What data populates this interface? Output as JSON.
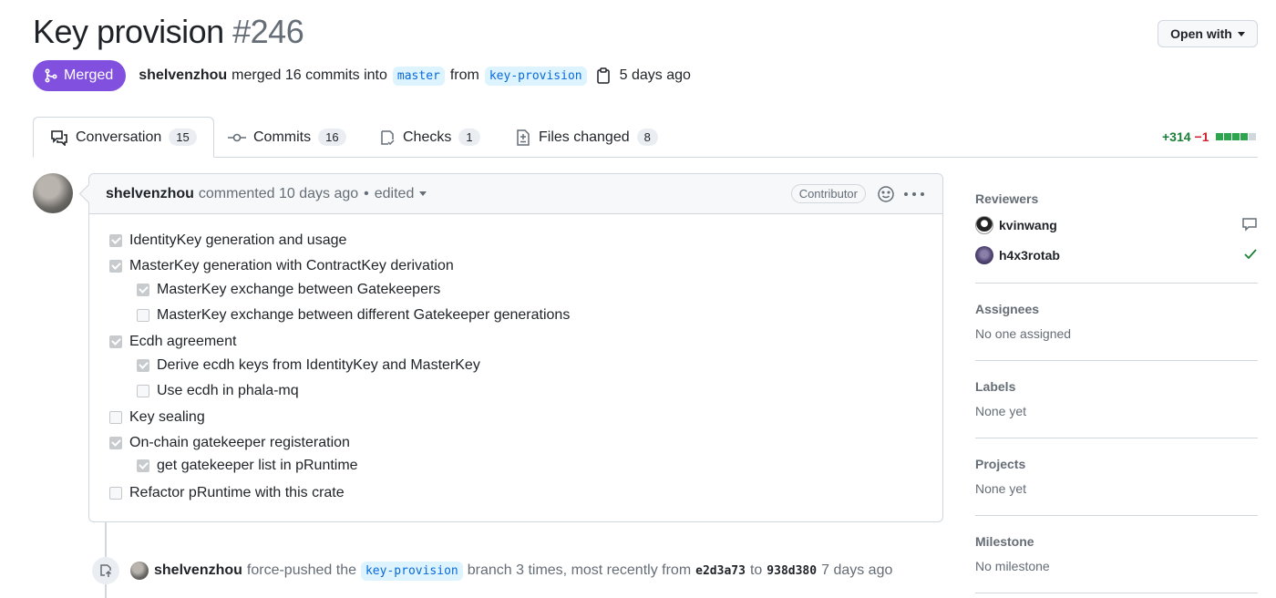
{
  "header": {
    "title": "Key provision",
    "number": "#246",
    "open_with_label": "Open with"
  },
  "meta": {
    "status": "Merged",
    "author": "shelvenzhou",
    "merged_text": "merged 16 commits into",
    "base_branch": "master",
    "from_text": "from",
    "head_branch": "key-provision",
    "time": "5 days ago"
  },
  "tabs": [
    {
      "label": "Conversation",
      "count": "15",
      "icon": "comment-discussion-icon"
    },
    {
      "label": "Commits",
      "count": "16",
      "icon": "git-commit-icon"
    },
    {
      "label": "Checks",
      "count": "1",
      "icon": "checklist-icon"
    },
    {
      "label": "Files changed",
      "count": "8",
      "icon": "file-diff-icon"
    }
  ],
  "diffstat": {
    "additions": "+314",
    "deletions": "−1"
  },
  "comment": {
    "author": "shelvenzhou",
    "action": "commented",
    "time": "10 days ago",
    "separator": "•",
    "edited": "edited",
    "role": "Contributor",
    "tasks": [
      {
        "label": "IdentityKey generation and usage",
        "checked": true,
        "level": 0
      },
      {
        "label": "MasterKey generation with ContractKey derivation",
        "checked": true,
        "level": 0
      },
      {
        "label": "MasterKey exchange between Gatekeepers",
        "checked": true,
        "level": 1
      },
      {
        "label": "MasterKey exchange between different Gatekeeper generations",
        "checked": false,
        "level": 1
      },
      {
        "label": "Ecdh agreement",
        "checked": true,
        "level": 0
      },
      {
        "label": "Derive ecdh keys from IdentityKey and MasterKey",
        "checked": true,
        "level": 1
      },
      {
        "label": "Use ecdh in phala-mq",
        "checked": false,
        "level": 1
      },
      {
        "label": "Key sealing",
        "checked": false,
        "level": 0
      },
      {
        "label": "On-chain gatekeeper registeration",
        "checked": true,
        "level": 0
      },
      {
        "label": "get gatekeeper list in pRuntime",
        "checked": true,
        "level": 1
      },
      {
        "label": "Refactor pRuntime with this crate",
        "checked": false,
        "level": 0
      }
    ]
  },
  "timeline": {
    "author": "shelvenzhou",
    "text1": "force-pushed the",
    "branch": "key-provision",
    "text2": "branch 3 times, most recently from",
    "from_sha": "e2d3a73",
    "to_text": "to",
    "to_sha": "938d380",
    "time": "7 days ago"
  },
  "sidebar": {
    "reviewers_title": "Reviewers",
    "reviewers": [
      {
        "name": "kvinwang",
        "status": "comment-icon"
      },
      {
        "name": "h4x3rotab",
        "status": "check-icon"
      }
    ],
    "assignees_title": "Assignees",
    "assignees_value": "No one assigned",
    "labels_title": "Labels",
    "labels_value": "None yet",
    "projects_title": "Projects",
    "projects_value": "None yet",
    "milestone_title": "Milestone",
    "milestone_value": "No milestone"
  },
  "colors": {
    "merged": "#8250df",
    "link": "#0969da",
    "addition": "#1a7f37",
    "deletion": "#cf222e"
  }
}
